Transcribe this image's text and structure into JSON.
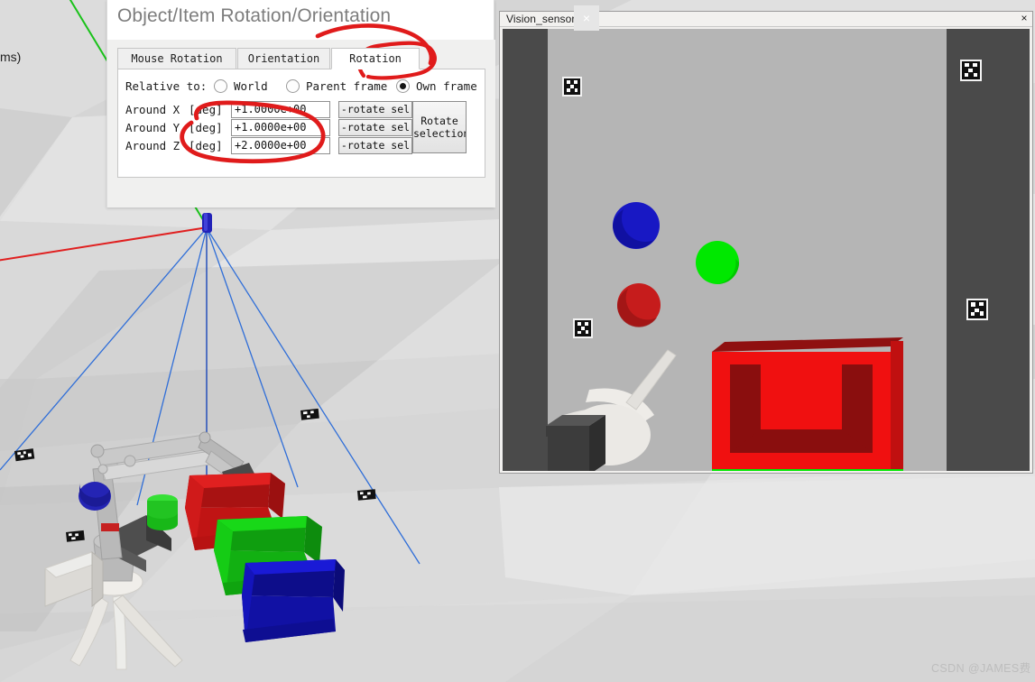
{
  "app": {
    "scene_label": "ms)",
    "watermark": "CSDN @JAMES费"
  },
  "vision_window": {
    "title": "Vision_sensor",
    "close_label": "×",
    "objects": [
      {
        "name": "blue-sphere",
        "color": "#1414c8"
      },
      {
        "name": "green-sphere",
        "color": "#00e000"
      },
      {
        "name": "red-sphere",
        "color": "#be1515"
      },
      {
        "name": "red-bin",
        "color": "#f01010"
      },
      {
        "name": "green-platform",
        "color": "#00e000"
      },
      {
        "name": "robot-arm",
        "color": "#e8e6e2"
      }
    ],
    "markers": [
      "aruco-marker-top-left",
      "aruco-marker-top-right",
      "aruco-marker-mid-left",
      "aruco-marker-mid-right"
    ],
    "background_color": "#b5b5b5",
    "letterbox_color": "#4a4a4a"
  },
  "rotation_dialog": {
    "title": "Object/Item Rotation/Orientation",
    "close_label": "×",
    "tabs": [
      {
        "label": "Mouse Rotation",
        "active": false
      },
      {
        "label": "Orientation",
        "active": false
      },
      {
        "label": "Rotation",
        "active": true
      }
    ],
    "relative_to": {
      "label": "Relative to:",
      "options": [
        {
          "label": "World",
          "selected": false
        },
        {
          "label": "Parent frame",
          "selected": false
        },
        {
          "label": "Own frame",
          "selected": true
        }
      ]
    },
    "axes": [
      {
        "name": "Around X",
        "unit": "[deg]",
        "value": "+1.0000e+00",
        "button": "-rotate sel"
      },
      {
        "name": "Around Y",
        "unit": "[deg]",
        "value": "+1.0000e+00",
        "button": "-rotate sel"
      },
      {
        "name": "Around Z",
        "unit": "[deg]",
        "value": "+2.0000e+00",
        "button": "-rotate sel"
      }
    ],
    "rotate_selection_line1": "Rotate",
    "rotate_selection_line2": "selection"
  },
  "annotations": {
    "accent_color": "#e01b1b",
    "shapes": [
      "circle-around-rotation-tab",
      "circle-around-angle-fields"
    ]
  },
  "scene": {
    "floor_colors": [
      "#e3e3e3",
      "#d0d0d0",
      "#c6c6c6",
      "#dadada"
    ],
    "axis_x_color": "#e02020",
    "axis_y_color": "#19c219",
    "frustum_color": "#2f6ed8",
    "bins": [
      {
        "name": "red-bin",
        "color": "#cf1414"
      },
      {
        "name": "green-bin",
        "color": "#15cc15"
      },
      {
        "name": "blue-bin",
        "color": "#1414bb"
      }
    ],
    "parts": [
      {
        "name": "green-cylinder",
        "color": "#24d424"
      },
      {
        "name": "blue-cylinder",
        "color": "#2222b8"
      }
    ]
  }
}
